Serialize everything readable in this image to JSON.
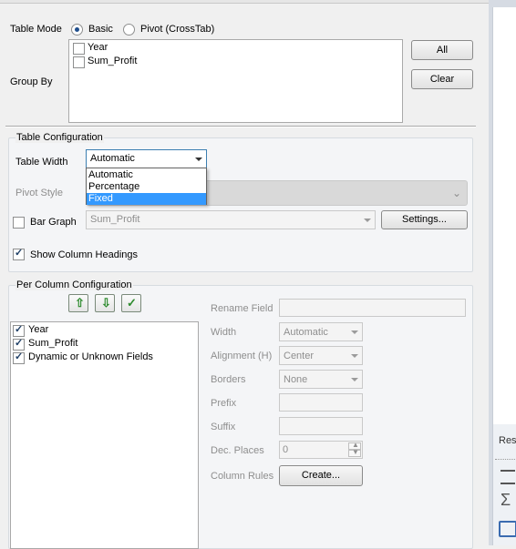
{
  "table_mode": {
    "label": "Table Mode",
    "options": [
      {
        "label": "Basic",
        "selected": true
      },
      {
        "label": "Pivot (CrossTab)",
        "selected": false
      }
    ]
  },
  "group_by": {
    "label": "Group By",
    "fields": [
      {
        "label": "Year",
        "checked": false
      },
      {
        "label": "Sum_Profit",
        "checked": false
      }
    ],
    "all_label": "All",
    "clear_label": "Clear"
  },
  "table_config": {
    "title": "Table Configuration",
    "table_width_label": "Table Width",
    "table_width_value": "Automatic",
    "table_width_options": [
      "Automatic",
      "Percentage",
      "Fixed"
    ],
    "highlighted_option": "Fixed",
    "pivot_style_label": "Pivot Style",
    "bar_graph_label": "Bar Graph",
    "bar_graph_checked": false,
    "bar_graph_field": "Sum_Profit",
    "settings_label": "Settings...",
    "show_headings_label": "Show Column Headings",
    "show_headings_checked": true
  },
  "per_column": {
    "title": "Per Column Configuration",
    "fields": [
      {
        "label": "Year",
        "checked": true
      },
      {
        "label": "Sum_Profit",
        "checked": true
      },
      {
        "label": "Dynamic or Unknown Fields",
        "checked": true
      }
    ],
    "rename_label": "Rename Field",
    "width_label": "Width",
    "width_value": "Automatic",
    "alignment_label": "Alignment (H)",
    "alignment_value": "Center",
    "borders_label": "Borders",
    "borders_value": "None",
    "prefix_label": "Prefix",
    "suffix_label": "Suffix",
    "dec_places_label": "Dec. Places",
    "dec_places_value": "0",
    "column_rules_label": "Column Rules",
    "create_label": "Create..."
  },
  "right_panel": {
    "tab_label": "Res"
  },
  "colors": {
    "accent": "#3399ff",
    "highlight_text": "#ffffff"
  }
}
